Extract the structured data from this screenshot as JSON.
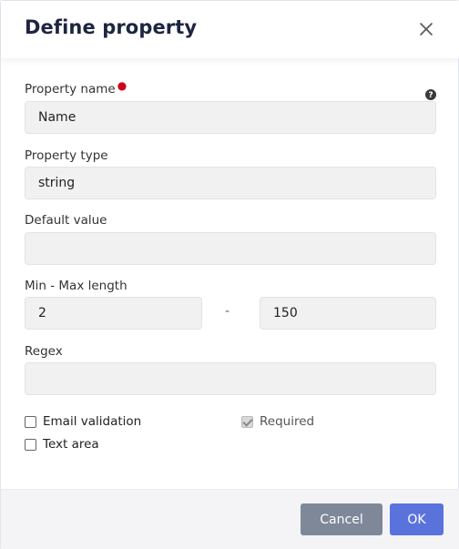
{
  "dialog": {
    "title": "Define property",
    "close_icon": "close-icon"
  },
  "fields": {
    "property_name": {
      "label": "Property name",
      "value": "Name",
      "required": true,
      "help_icon": "question-circle-icon"
    },
    "property_type": {
      "label": "Property type",
      "value": "string"
    },
    "default_value": {
      "label": "Default value",
      "value": ""
    },
    "min_max_length": {
      "label": "Min - Max length",
      "min": "2",
      "separator": "-",
      "max": "150"
    },
    "regex": {
      "label": "Regex",
      "value": ""
    }
  },
  "checkboxes": {
    "email_validation": {
      "label": "Email validation",
      "checked": false
    },
    "required": {
      "label": "Required",
      "checked": true,
      "disabled": true
    },
    "text_area": {
      "label": "Text area",
      "checked": false
    }
  },
  "footer": {
    "cancel_label": "Cancel",
    "ok_label": "OK"
  },
  "colors": {
    "title": "#1d2640",
    "required_dot": "#d0021b",
    "cancel_button": "#7e8898",
    "ok_button": "#5a73dc",
    "field_bg": "#f1f1f1"
  }
}
